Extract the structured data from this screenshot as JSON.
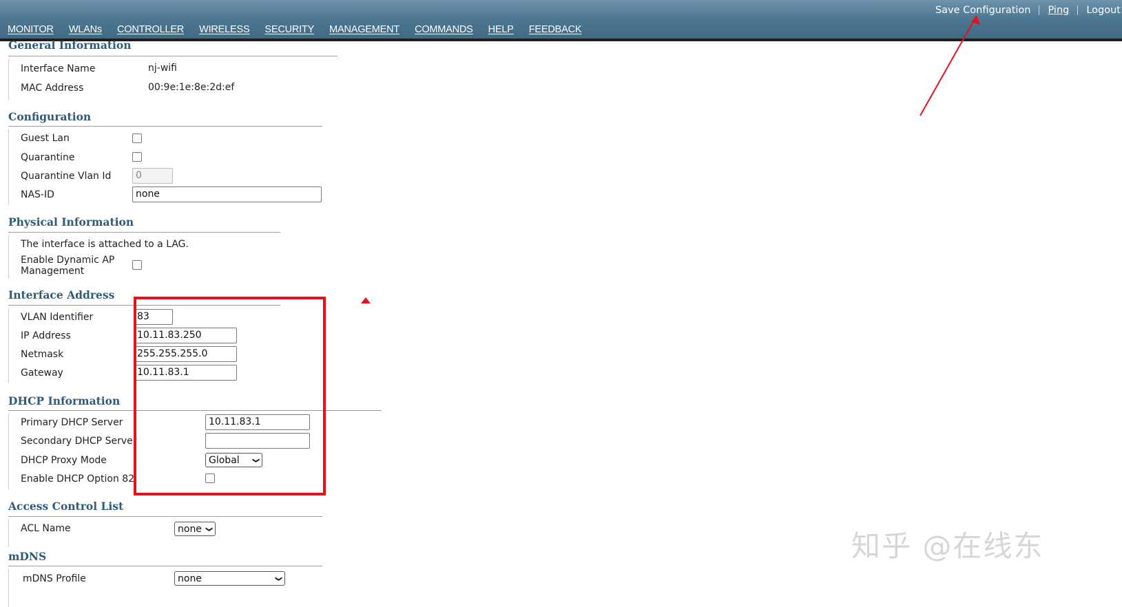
{
  "header": {
    "links": [
      "Save Configuration",
      "Ping",
      "Logout"
    ],
    "menu": [
      "MONITOR",
      "WLANs",
      "CONTROLLER",
      "WIRELESS",
      "SECURITY",
      "MANAGEMENT",
      "COMMANDS",
      "HELP",
      "FEEDBACK"
    ],
    "active_menu": "CONTROLLER"
  },
  "general": {
    "title": "General Information",
    "interface_name_label": "Interface Name",
    "interface_name_value": "nj-wifi",
    "mac_label": "MAC Address",
    "mac_value": "00:9e:1e:8e:2d:ef"
  },
  "configuration": {
    "title": "Configuration",
    "guest_lan_label": "Guest Lan",
    "quarantine_label": "Quarantine",
    "quarantine_vlan_label": "Quarantine Vlan Id",
    "quarantine_vlan_value": "0",
    "nas_id_label": "NAS-ID",
    "nas_id_value": "none"
  },
  "physical": {
    "title": "Physical Information",
    "lag_text": "The interface is attached to a LAG.",
    "dynamic_ap_label_1": "Enable Dynamic AP",
    "dynamic_ap_label_2": "Management"
  },
  "interface_address": {
    "title": "Interface Address",
    "vlan_label": "VLAN Identifier",
    "vlan_value": "83",
    "ip_label": "IP Address",
    "ip_value": "10.11.83.250",
    "netmask_label": "Netmask",
    "netmask_value": "255.255.255.0",
    "gateway_label": "Gateway",
    "gateway_value": "10.11.83.1"
  },
  "dhcp": {
    "title": "DHCP Information",
    "primary_label": "Primary DHCP Server",
    "primary_value": "10.11.83.1",
    "secondary_label": "Secondary DHCP Server",
    "secondary_value": "",
    "proxy_label": "DHCP Proxy Mode",
    "proxy_value": "Global",
    "option82_label": "Enable DHCP Option 82"
  },
  "acl": {
    "title": "Access Control List",
    "acl_name_label": "ACL Name",
    "acl_name_value": "none"
  },
  "mdns": {
    "title": "mDNS",
    "profile_label": "mDNS Profile",
    "profile_value": "none"
  },
  "watermark": "知乎 @在线东",
  "colors": {
    "header": "#4e7893",
    "section_title": "#2e5b7c",
    "active_tab_underline": "#f08c1e",
    "annotation_red": "#e8101a"
  }
}
